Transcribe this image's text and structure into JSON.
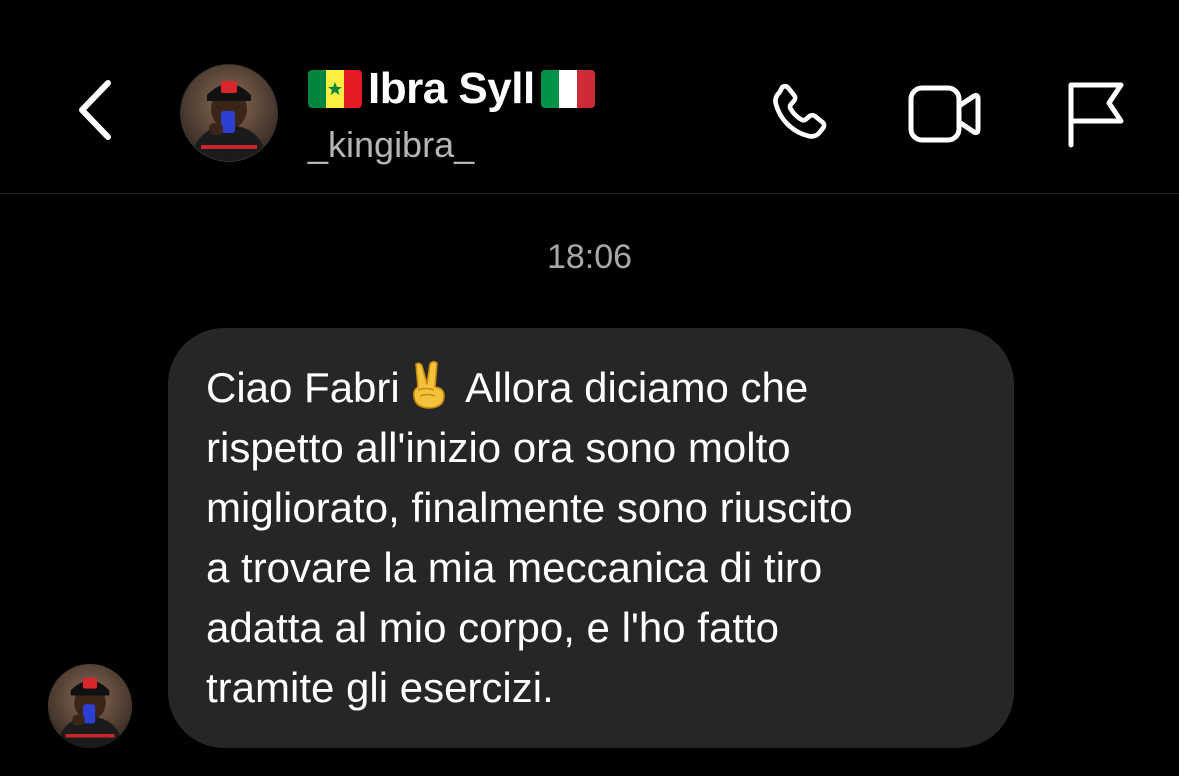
{
  "header": {
    "display_name": "Ibra Syll",
    "username": "_kingibra_",
    "flag_left": {
      "name": "senegal-flag",
      "colors": [
        "#00853F",
        "#FDEF42",
        "#E31B23"
      ]
    },
    "flag_right": {
      "name": "italy-flag",
      "colors": [
        "#009246",
        "#FFFFFF",
        "#CE2B37"
      ]
    },
    "icons": [
      "chevron-left-icon",
      "phone-icon",
      "video-camera-icon",
      "flag-icon"
    ]
  },
  "thread": {
    "timestamp": "18:06",
    "message": {
      "text_before_emoji": "Ciao Fabri",
      "emoji": "victory-hand-emoji",
      "text_after_emoji": " Allora diciamo che\nrispetto all'inizio ora sono molto\nmigliorato, finalmente sono riuscito\na trovare la mia meccanica di tiro\nadatta al mio corpo, e l'ho fatto\ntramite gli esercizi."
    }
  },
  "colors": {
    "background": "#000000",
    "bubble": "#262626",
    "secondary_text": "#a8a8a8"
  }
}
